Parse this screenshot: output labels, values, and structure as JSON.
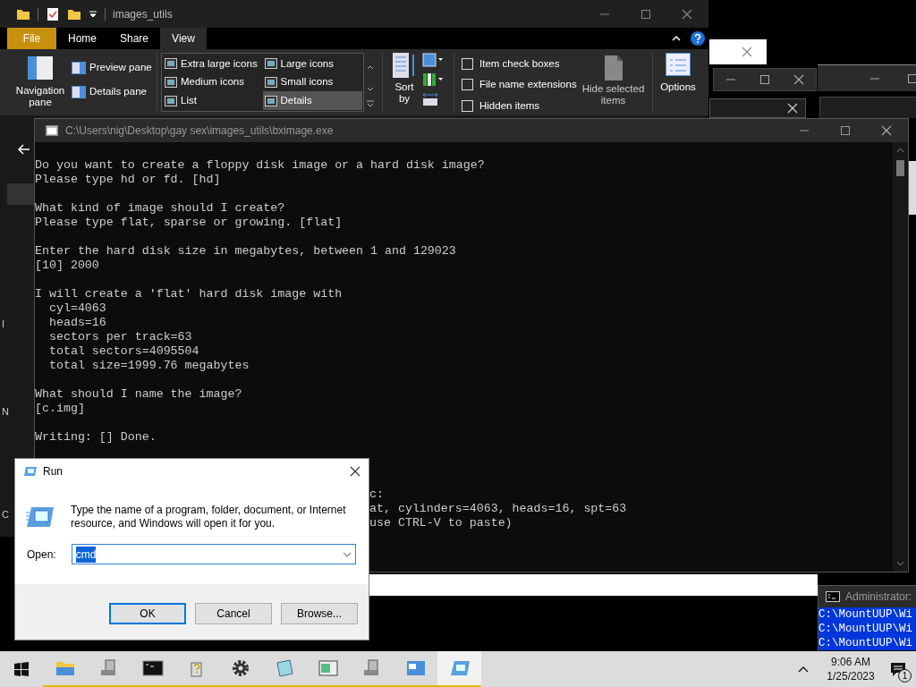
{
  "explorer": {
    "title": "images_utils",
    "tabs": [
      {
        "label": "File",
        "kind": "file",
        "selected": false
      },
      {
        "label": "Home",
        "kind": "tab",
        "selected": false
      },
      {
        "label": "Share",
        "kind": "tab",
        "selected": false
      },
      {
        "label": "View",
        "kind": "tab",
        "selected": true
      }
    ],
    "panes": {
      "navigation": "Navigation pane",
      "preview": "Preview pane",
      "details": "Details pane"
    },
    "layouts": [
      {
        "label": "Extra large icons",
        "selected": false
      },
      {
        "label": "Large icons",
        "selected": false
      },
      {
        "label": "Medium icons",
        "selected": false
      },
      {
        "label": "Small icons",
        "selected": false
      },
      {
        "label": "List",
        "selected": false
      },
      {
        "label": "Details",
        "selected": true
      }
    ],
    "sort_by": "Sort by",
    "show_hide": [
      {
        "label": "Item check boxes",
        "checked": false
      },
      {
        "label": "File name extensions",
        "checked": false
      },
      {
        "label": "Hidden items",
        "checked": false
      }
    ],
    "hide_selected": "Hide selected items",
    "options": "Options",
    "sidebar_fragments": [
      "I",
      "N",
      "C"
    ]
  },
  "console": {
    "title": "C:\\Users\\nig\\Desktop\\gay sex\\images_utils\\bximage.exe",
    "blocks": [
      [
        "Do you want to create a floppy disk image or a hard disk image?",
        "Please type hd or fd. [hd]"
      ],
      [
        "What kind of image should I create?",
        "Please type flat, sparse or growing. [flat]"
      ],
      [
        "Enter the hard disk size in megabytes, between 1 and 129023",
        "[10] 2000"
      ],
      [
        "I will create a 'flat' hard disk image with",
        "  cyl=4063",
        "  heads=16",
        "  sectors per track=63",
        "  total sectors=4095504",
        "  total size=1999.76 megabytes"
      ],
      [
        "What should I name the image?",
        "[c.img]"
      ],
      [
        "Writing: [] Done."
      ]
    ],
    "partial_lines": [
      "c:",
      "at, cylinders=4063, heads=16, spt=63",
      "use CTRL-V to paste)"
    ]
  },
  "run_dialog": {
    "title": "Run",
    "description": "Type the name of a program, folder, document, or Internet resource, and Windows will open it for you.",
    "open_label": "Open:",
    "value": "cmd",
    "value_selected": true,
    "buttons": [
      {
        "label": "OK",
        "default": true
      },
      {
        "label": "Cancel",
        "default": false
      },
      {
        "label": "Browse...",
        "default": false
      }
    ]
  },
  "admin_console": {
    "title": "Administrator:",
    "lines": [
      "C:\\MountUUP\\Wi",
      "C:\\MountUUP\\Wi",
      "C:\\MountUUP\\Wi"
    ],
    "highlighted": true
  },
  "taskbar": {
    "items": [
      {
        "kind": "explorer",
        "selected": false
      },
      {
        "kind": "drive",
        "selected": false
      },
      {
        "kind": "cmd",
        "selected": false
      },
      {
        "kind": "help",
        "selected": false
      },
      {
        "kind": "gear",
        "selected": false
      },
      {
        "kind": "notepad",
        "selected": false
      },
      {
        "kind": "window",
        "selected": false
      },
      {
        "kind": "drive",
        "selected": false
      },
      {
        "kind": "network",
        "selected": false
      },
      {
        "kind": "run",
        "selected": true
      }
    ],
    "time": "9:06 AM",
    "date": "1/25/2023",
    "notification_count": "1"
  }
}
